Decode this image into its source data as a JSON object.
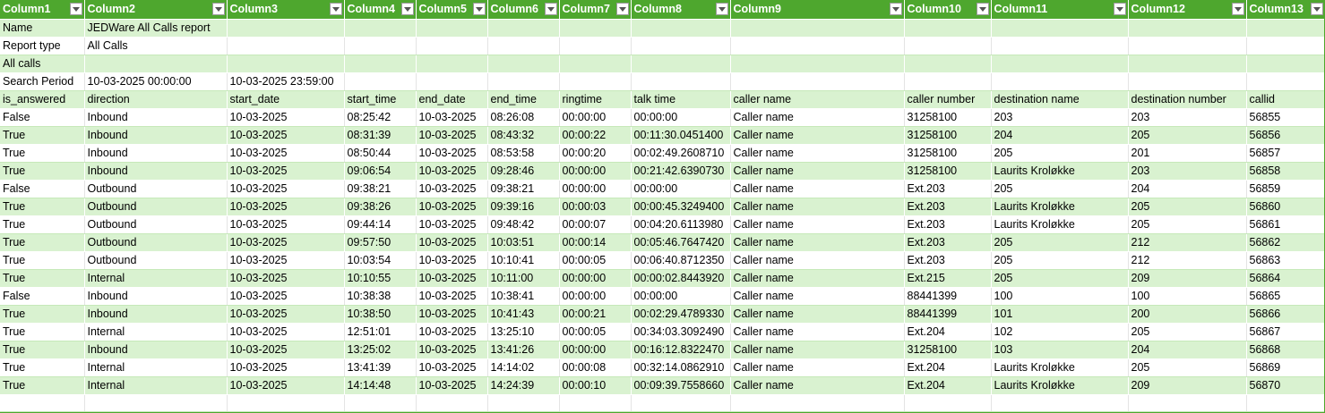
{
  "headers": [
    "Column1",
    "Column2",
    "Column3",
    "Column4",
    "Column5",
    "Column6",
    "Column7",
    "Column8",
    "Column9",
    "Column10",
    "Column11",
    "Column12",
    "Column13"
  ],
  "rows": [
    [
      "Name",
      "JEDWare All Calls report",
      "",
      "",
      "",
      "",
      "",
      "",
      "",
      "",
      "",
      "",
      ""
    ],
    [
      "Report type",
      "All Calls",
      "",
      "",
      "",
      "",
      "",
      "",
      "",
      "",
      "",
      "",
      ""
    ],
    [
      "All calls",
      "",
      "",
      "",
      "",
      "",
      "",
      "",
      "",
      "",
      "",
      "",
      ""
    ],
    [
      "Search Period",
      "10-03-2025 00:00:00",
      "10-03-2025 23:59:00",
      "",
      "",
      "",
      "",
      "",
      "",
      "",
      "",
      "",
      ""
    ],
    [
      "is_answered",
      "direction",
      "start_date",
      "start_time",
      "end_date",
      "end_time",
      "ringtime",
      "talk time",
      "caller name",
      "caller number",
      "destination name",
      "destination number",
      "callid"
    ],
    [
      "False",
      "Inbound",
      "10-03-2025",
      "08:25:42",
      "10-03-2025",
      "08:26:08",
      "00:00:00",
      "00:00:00",
      "Caller name",
      "31258100",
      "203",
      "203",
      "56855"
    ],
    [
      "True",
      "Inbound",
      "10-03-2025",
      "08:31:39",
      "10-03-2025",
      "08:43:32",
      "00:00:22",
      "00:11:30.0451400",
      "Caller name",
      "31258100",
      "204",
      "205",
      "56856"
    ],
    [
      "True",
      "Inbound",
      "10-03-2025",
      "08:50:44",
      "10-03-2025",
      "08:53:58",
      "00:00:20",
      "00:02:49.2608710",
      "Caller name",
      "31258100",
      "205",
      "201",
      "56857"
    ],
    [
      "True",
      "Inbound",
      "10-03-2025",
      "09:06:54",
      "10-03-2025",
      "09:28:46",
      "00:00:00",
      "00:21:42.6390730",
      "Caller name",
      "31258100",
      "Laurits Kroløkke",
      "203",
      "56858"
    ],
    [
      "False",
      "Outbound",
      "10-03-2025",
      "09:38:21",
      "10-03-2025",
      "09:38:21",
      "00:00:00",
      "00:00:00",
      "Caller name",
      "Ext.203",
      "205",
      "204",
      "56859"
    ],
    [
      "True",
      "Outbound",
      "10-03-2025",
      "09:38:26",
      "10-03-2025",
      "09:39:16",
      "00:00:03",
      "00:00:45.3249400",
      "Caller name",
      "Ext.203",
      "Laurits Kroløkke",
      "205",
      "56860"
    ],
    [
      "True",
      "Outbound",
      "10-03-2025",
      "09:44:14",
      "10-03-2025",
      "09:48:42",
      "00:00:07",
      "00:04:20.6113980",
      "Caller name",
      "Ext.203",
      "Laurits Kroløkke",
      "205",
      "56861"
    ],
    [
      "True",
      "Outbound",
      "10-03-2025",
      "09:57:50",
      "10-03-2025",
      "10:03:51",
      "00:00:14",
      "00:05:46.7647420",
      "Caller name",
      "Ext.203",
      "205",
      "212",
      "56862"
    ],
    [
      "True",
      "Outbound",
      "10-03-2025",
      "10:03:54",
      "10-03-2025",
      "10:10:41",
      "00:00:05",
      "00:06:40.8712350",
      "Caller name",
      "Ext.203",
      "205",
      "212",
      "56863"
    ],
    [
      "True",
      "Internal",
      "10-03-2025",
      "10:10:55",
      "10-03-2025",
      "10:11:00",
      "00:00:00",
      "00:00:02.8443920",
      "Caller name",
      "Ext.215",
      "205",
      "209",
      "56864"
    ],
    [
      "False",
      "Inbound",
      "10-03-2025",
      "10:38:38",
      "10-03-2025",
      "10:38:41",
      "00:00:00",
      "00:00:00",
      "Caller name",
      "88441399",
      "100",
      "100",
      "56865"
    ],
    [
      "True",
      "Inbound",
      "10-03-2025",
      "10:38:50",
      "10-03-2025",
      "10:41:43",
      "00:00:21",
      "00:02:29.4789330",
      "Caller name",
      "88441399",
      "101",
      "200",
      "56866"
    ],
    [
      "True",
      "Internal",
      "10-03-2025",
      "12:51:01",
      "10-03-2025",
      "13:25:10",
      "00:00:05",
      "00:34:03.3092490",
      "Caller name",
      "Ext.204",
      "102",
      "205",
      "56867"
    ],
    [
      "True",
      "Inbound",
      "10-03-2025",
      "13:25:02",
      "10-03-2025",
      "13:41:26",
      "00:00:00",
      "00:16:12.8322470",
      "Caller name",
      "31258100",
      "103",
      "204",
      "56868"
    ],
    [
      "True",
      "Internal",
      "10-03-2025",
      "13:41:39",
      "10-03-2025",
      "14:14:02",
      "00:00:08",
      "00:32:14.0862910",
      "Caller name",
      "Ext.204",
      "Laurits Kroløkke",
      "205",
      "56869"
    ],
    [
      "True",
      "Internal",
      "10-03-2025",
      "14:14:48",
      "10-03-2025",
      "14:24:39",
      "00:00:10",
      "00:09:39.7558660",
      "Caller name",
      "Ext.204",
      "Laurits Kroløkke",
      "209",
      "56870"
    ],
    [
      "",
      "",
      "",
      "",
      "",
      "",
      "",
      "",
      "",
      "",
      "",
      "",
      ""
    ]
  ],
  "colors": {
    "header": "#4ea72e",
    "band": "#d9f2d0"
  },
  "icons": {
    "filter": "dropdown-arrow-icon"
  }
}
